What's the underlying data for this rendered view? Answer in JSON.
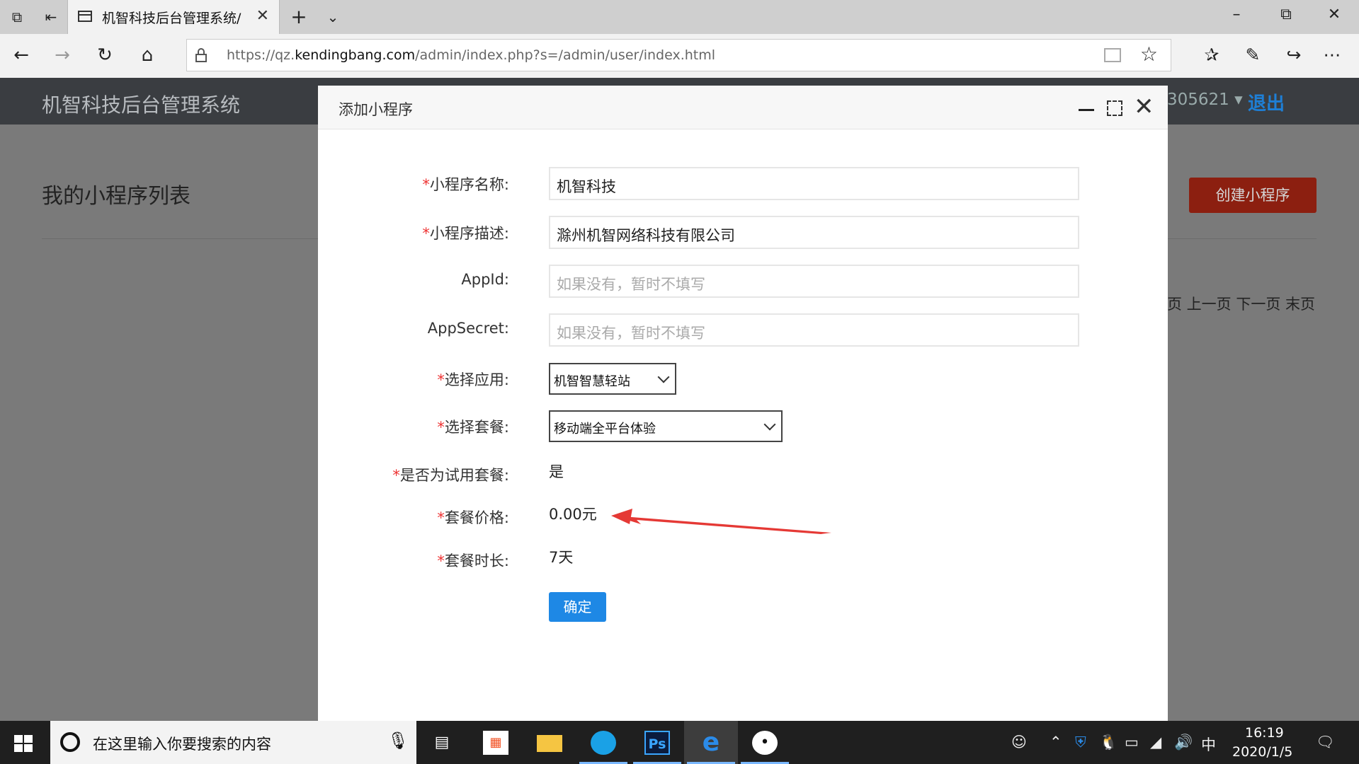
{
  "browser": {
    "tab_title": "机智科技后台管理系统/",
    "url_prefix": "https://qz.",
    "url_domain": "kendingbang.com",
    "url_path": "/admin/index.php?s=/admin/user/index.html"
  },
  "app": {
    "title": "机智科技后台管理系统",
    "user_id": "305621",
    "logout_label": "退出"
  },
  "page": {
    "title": "我的小程序列表",
    "create_button": "创建小程序",
    "pager": "页 上一页 下一页 末页"
  },
  "modal": {
    "title": "添加小程序",
    "form": {
      "name_label": "小程序名称:",
      "name_value": "机智科技",
      "desc_label": "小程序描述:",
      "desc_value": "滁州机智网络科技有限公司",
      "appid_label": "AppId:",
      "appid_placeholder": "如果没有，暂时不填写",
      "appsecret_label": "AppSecret:",
      "appsecret_placeholder": "如果没有，暂时不填写",
      "app_label": "选择应用:",
      "app_selected": "机智智慧轻站",
      "package_label": "选择套餐:",
      "package_selected": "移动端全平台体验",
      "trial_label": "是否为试用套餐:",
      "trial_value": "是",
      "price_label": "套餐价格:",
      "price_value": "0.00元",
      "duration_label": "套餐时长:",
      "duration_value": "7天",
      "required_mark": "*",
      "submit_label": "确定"
    }
  },
  "taskbar": {
    "search_placeholder": "在这里输入你要搜索的内容",
    "ime": "中",
    "time": "16:19",
    "date": "2020/1/5"
  },
  "colors": {
    "header_bg": "#3a3d41",
    "logout": "#1e7fd6",
    "create_button": "#8c1f10",
    "primary_button": "#1e88e5",
    "required": "#e33333",
    "annotation_arrow": "#e53935"
  }
}
